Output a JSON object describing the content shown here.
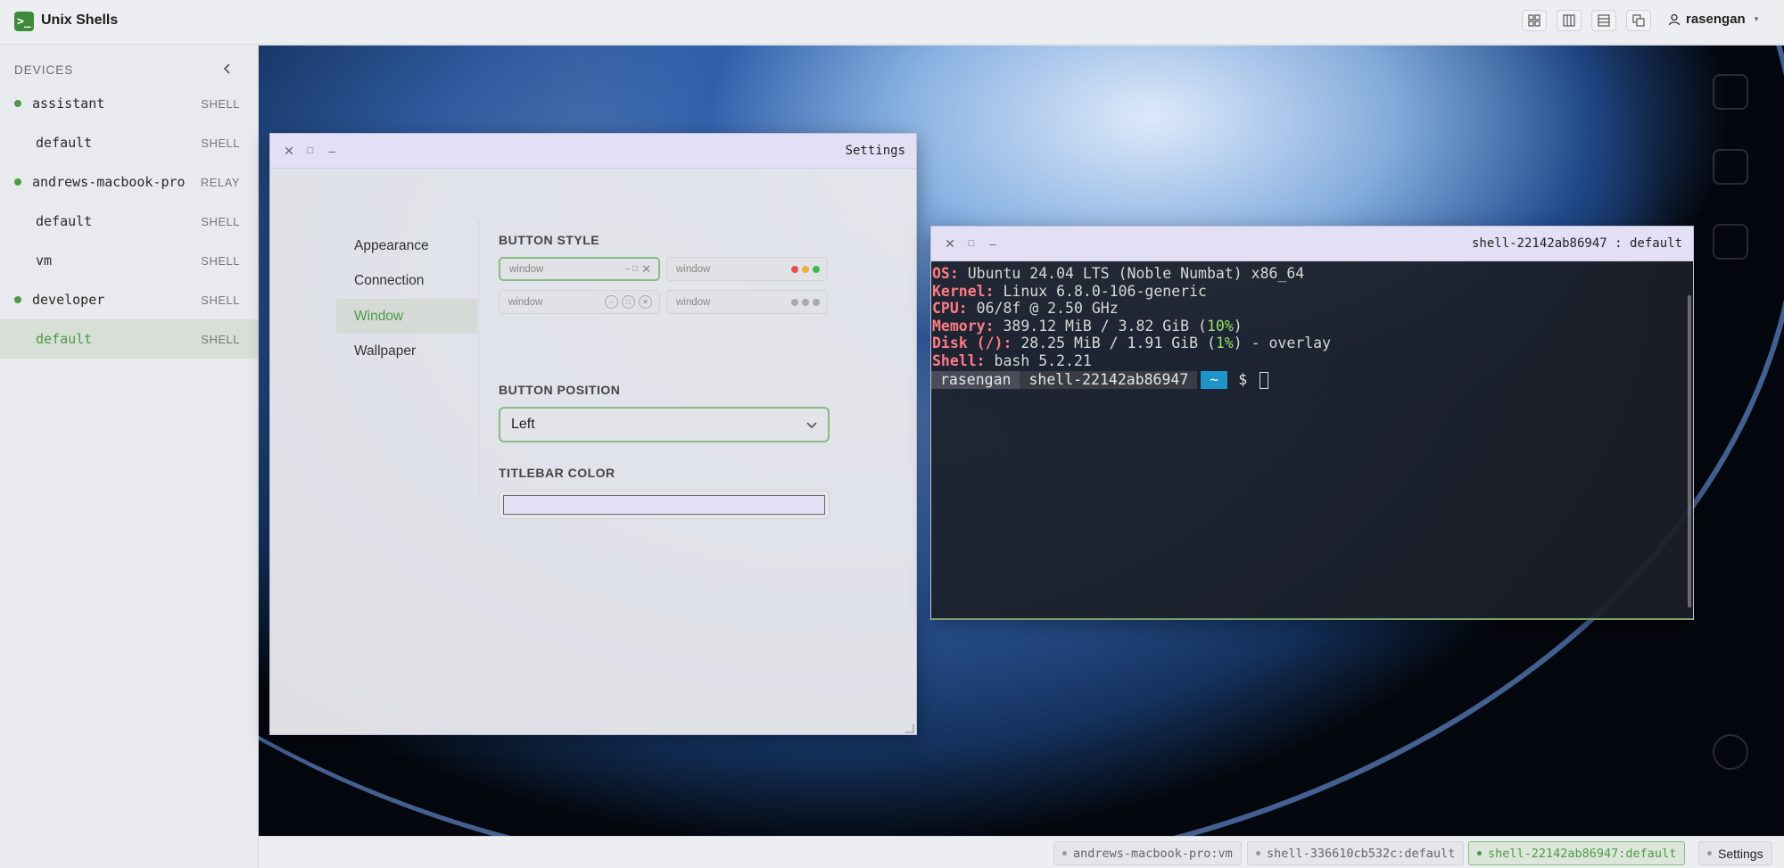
{
  "app": {
    "title": "Unix Shells",
    "logo_glyph": ">_"
  },
  "header": {
    "user": "rasengan",
    "layout_buttons": [
      "grid-layout",
      "columns-layout",
      "rows-layout",
      "cascade-layout"
    ]
  },
  "sidebar": {
    "heading": "DEVICES",
    "items": [
      {
        "name": "assistant",
        "kind": "SHELL",
        "online": true,
        "child": false,
        "active": false
      },
      {
        "name": "default",
        "kind": "SHELL",
        "online": false,
        "child": true,
        "active": false
      },
      {
        "name": "andrews-macbook-pro",
        "kind": "RELAY",
        "online": true,
        "child": false,
        "active": false
      },
      {
        "name": "default",
        "kind": "SHELL",
        "online": false,
        "child": true,
        "active": false
      },
      {
        "name": "vm",
        "kind": "SHELL",
        "online": false,
        "child": true,
        "active": false
      },
      {
        "name": "developer",
        "kind": "SHELL",
        "online": true,
        "child": false,
        "active": false
      },
      {
        "name": "default",
        "kind": "SHELL",
        "online": false,
        "child": true,
        "active": true
      }
    ]
  },
  "settings_window": {
    "title": "Settings",
    "nav": [
      "Appearance",
      "Connection",
      "Window",
      "Wallpaper"
    ],
    "active_nav": "Window",
    "button_style_label": "BUTTON STYLE",
    "style_options": [
      "window",
      "window",
      "window",
      "window"
    ],
    "button_position_label": "BUTTON POSITION",
    "button_position_value": "Left",
    "titlebar_color_label": "TITLEBAR COLOR",
    "titlebar_color_value": "#e3e0f6"
  },
  "terminal_window": {
    "title": "shell-22142ab86947 : default",
    "lines": {
      "os_key": "OS:",
      "os_val": " Ubuntu 24.04 LTS (Noble Numbat) x86_64",
      "kernel_key": "Kernel:",
      "kernel_val": " Linux 6.8.0-106-generic",
      "cpu_key": "CPU:",
      "cpu_val": " 06/8f @ 2.50 GHz",
      "mem_key": "Memory:",
      "mem_val_a": " 389.12 MiB / 3.82 GiB (",
      "mem_pct": "10%",
      "mem_val_b": ")",
      "disk_key": "Disk (/):",
      "disk_val_a": " 28.25 MiB / 1.91 GiB (",
      "disk_pct": "1%",
      "disk_val_b": ") - overlay",
      "shell_key": "Shell:",
      "shell_val": " bash 5.2.21"
    },
    "prompt": {
      "user": "rasengan",
      "host": "shell-22142ab86947",
      "dir": "~",
      "symbol": "$"
    }
  },
  "taskbar": {
    "tasks": [
      {
        "label": "andrews-macbook-pro:vm",
        "active": false
      },
      {
        "label": "shell-336610cb532c:default",
        "active": false
      },
      {
        "label": "shell-22142ab86947:default",
        "active": true
      },
      {
        "label": "Settings",
        "active": false
      }
    ]
  },
  "colors": {
    "accent": "#4c9a48",
    "titlebar": "#e3e0f6",
    "prompt_dir": "#1d95c8"
  }
}
